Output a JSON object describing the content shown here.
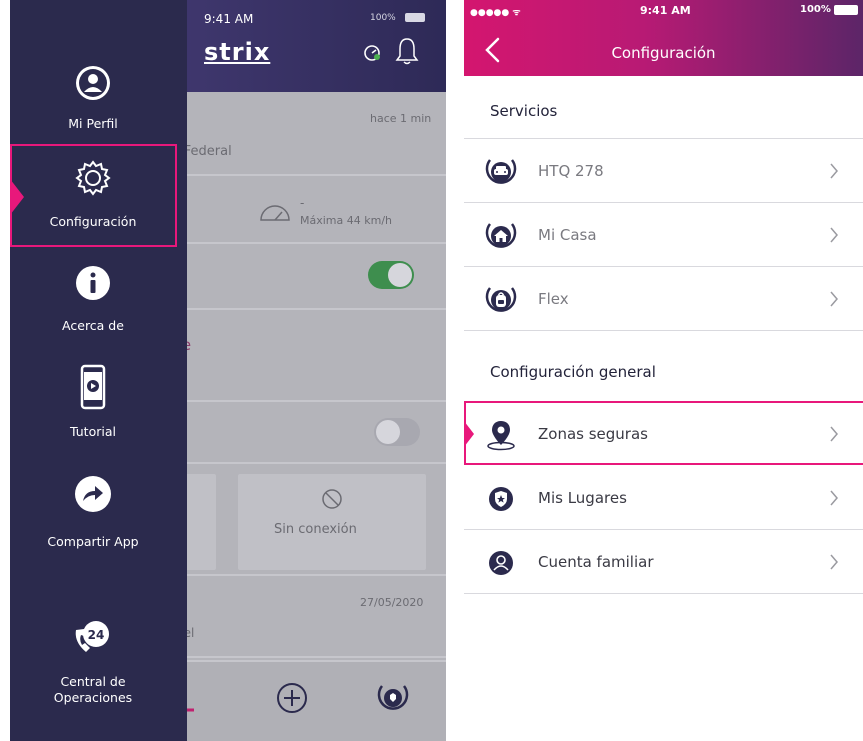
{
  "left_screen": {
    "status": {
      "time": "9:41 AM",
      "battery": "100%"
    },
    "logo": "strix",
    "background": {
      "updated": "hace 1 min",
      "location": "l Federal",
      "speed_dash": "-",
      "speed_max": "Máxima 44 km/h",
      "partial_te": "te",
      "partial_s": "s",
      "offline": "Sin conexión",
      "date": "27/05/2020",
      "partial_uel": "uel"
    },
    "drawer": {
      "items": [
        {
          "label": "Mi Perfil",
          "icon": "profile-icon"
        },
        {
          "label": "Configuración",
          "icon": "gear-icon"
        },
        {
          "label": "Acerca de",
          "icon": "info-icon"
        },
        {
          "label": "Tutorial",
          "icon": "tutorial-phone-icon"
        },
        {
          "label": "Compartir App",
          "icon": "share-icon"
        },
        {
          "label": "Central de Operaciones",
          "icon": "call-24-icon"
        }
      ]
    }
  },
  "right_screen": {
    "status": {
      "signal": "●●●●● ᯤ",
      "time": "9:41 AM",
      "battery": "100%"
    },
    "title": "Configuración",
    "services_title": "Servicios",
    "services": [
      {
        "label": "HTQ 278",
        "icon": "car-icon"
      },
      {
        "label": "Mi Casa",
        "icon": "home-icon"
      },
      {
        "label": "Flex",
        "icon": "backpack-icon"
      }
    ],
    "general_title": "Configuración general",
    "general": [
      {
        "label": "Zonas seguras",
        "icon": "location-pin-icon"
      },
      {
        "label": "Mis Lugares",
        "icon": "shield-star-icon"
      },
      {
        "label": "Cuenta familiar",
        "icon": "user-icon"
      }
    ]
  },
  "colors": {
    "accent": "#e8187b",
    "drawer": "#2b2a4d",
    "header_left": "#d4166f",
    "header_right": "#5c2568",
    "icon_dark": "#2b2a4d"
  }
}
